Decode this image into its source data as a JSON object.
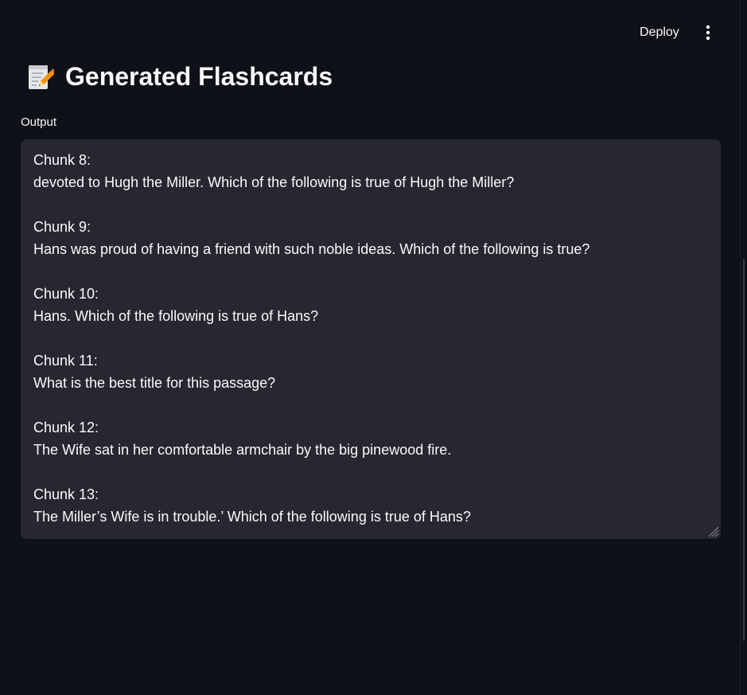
{
  "header": {
    "deploy_label": "Deploy",
    "menu_icon": "more-vertical-icon"
  },
  "main": {
    "title_icon": "memo-icon",
    "title": "Generated Flashcards",
    "output_label": "Output",
    "output_text": "Chunk 8:\ndevoted to Hugh the Miller. Which of the following is true of Hugh the Miller?\n\nChunk 9:\nHans was proud of having a friend with such noble ideas. Which of the following is true?\n\nChunk 10:\nHans. Which of the following is true of Hans?\n\nChunk 11:\nWhat is the best title for this passage?\n\nChunk 12:\nThe Wife sat in her comfortable armchair by the big pinewood fire.\n\nChunk 13:\nThe Miller’s Wife is in trouble.’ Which of the following is true of Hans?"
  },
  "colors": {
    "background": "#0e1117",
    "textarea_background": "#262730",
    "text": "#fafafa"
  }
}
